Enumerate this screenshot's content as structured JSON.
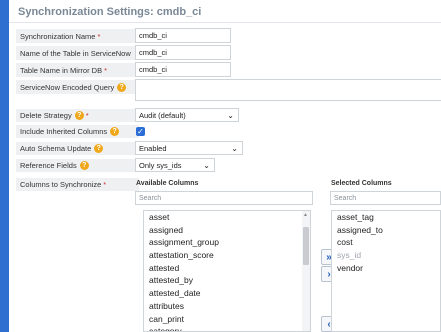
{
  "title": "Synchronization Settings: cmdb_ci",
  "fields": {
    "sync_name": {
      "label": "Synchronization Name",
      "required": "*",
      "value": "cmdb_ci"
    },
    "table_name": {
      "label": "Name of the Table in ServiceNow",
      "value": "cmdb_ci"
    },
    "mirror_table": {
      "label": "Table Name in Mirror DB",
      "required": "*",
      "value": "cmdb_ci"
    },
    "encoded_query": {
      "label": "ServiceNow Encoded Query",
      "value": ""
    },
    "delete_strategy": {
      "label": "Delete Strategy",
      "required": "*",
      "value": "Audit (default)"
    },
    "inherited_columns": {
      "label": "Include Inherited Columns",
      "checked": true
    },
    "auto_schema": {
      "label": "Auto Schema Update",
      "value": "Enabled"
    },
    "reference_fields": {
      "label": "Reference Fields",
      "value": "Only sys_ids"
    },
    "columns_sync": {
      "label": "Columns to Synchronize",
      "required": "*"
    }
  },
  "available": {
    "heading": "Available Columns",
    "search_placeholder": "Search",
    "items": [
      "asset",
      "assigned",
      "assignment_group",
      "attestation_score",
      "attested",
      "attested_by",
      "attested_date",
      "attributes",
      "can_print",
      "category"
    ]
  },
  "selected": {
    "heading": "Selected Columns",
    "search_placeholder": "Search",
    "items": [
      "asset_tag",
      "assigned_to",
      "cost",
      "sys_id",
      "vendor"
    ]
  },
  "icons": {
    "help": "help-icon",
    "move_all_right": "double-chevron-right-icon",
    "move_right": "chevron-right-icon",
    "move_left": "chevron-left-icon"
  },
  "colors": {
    "accent": "#2b6dd6",
    "help": "#f0a81a",
    "required": "#c9302c",
    "background": "#2f6fcf"
  }
}
